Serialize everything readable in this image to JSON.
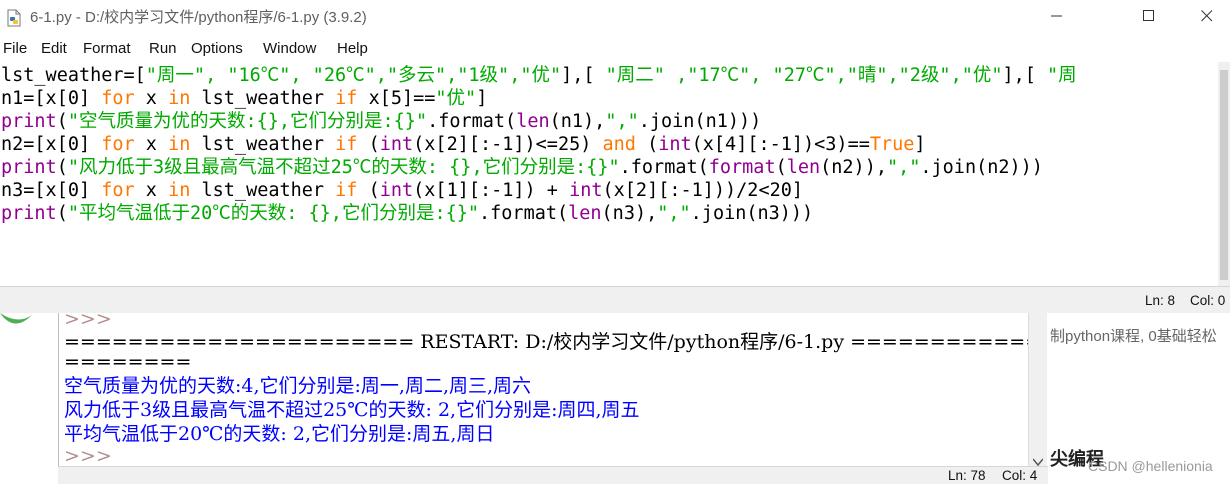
{
  "window": {
    "title": "6-1.py - D:/校内学习文件/python程序/6-1.py (3.9.2)"
  },
  "menu": [
    "File",
    "Edit",
    "Format",
    "Run",
    "Options",
    "Window",
    "Help"
  ],
  "editor": {
    "lines": [
      [
        [
          "t",
          "lst_weather=["
        ],
        [
          "s",
          "\"周一\", \"16℃\", \"26℃\",\"多云\",\"1级\",\"优\""
        ],
        [
          "t",
          "],[ "
        ],
        [
          "s",
          "\"周二\" ,\"17℃\", \"27℃\",\"晴\",\"2级\",\"优\""
        ],
        [
          "t",
          "],[ "
        ],
        [
          "s",
          "\"周"
        ]
      ],
      [
        [
          "t",
          "n1=[x[0] "
        ],
        [
          "k",
          "for"
        ],
        [
          "t",
          " x "
        ],
        [
          "k",
          "in"
        ],
        [
          "t",
          " lst_weather "
        ],
        [
          "k",
          "if"
        ],
        [
          "t",
          " x[5]=="
        ],
        [
          "s",
          "\"优\""
        ],
        [
          "t",
          "]"
        ]
      ],
      [
        [
          "b",
          "print"
        ],
        [
          "t",
          "("
        ],
        [
          "s",
          "\"空气质量为优的天数:{},它们分别是:{}\""
        ],
        [
          "t",
          "."
        ],
        [
          "t",
          "format("
        ],
        [
          "b",
          "len"
        ],
        [
          "t",
          "(n1),"
        ],
        [
          "s",
          "\",\""
        ],
        [
          "t",
          ".join(n1)))"
        ]
      ],
      [
        [
          "t",
          "n2=[x[0] "
        ],
        [
          "k",
          "for"
        ],
        [
          "t",
          " x "
        ],
        [
          "k",
          "in"
        ],
        [
          "t",
          " lst_weather "
        ],
        [
          "k",
          "if"
        ],
        [
          "t",
          " ("
        ],
        [
          "b",
          "int"
        ],
        [
          "t",
          "(x[2][:-1])<=25) "
        ],
        [
          "k",
          "and"
        ],
        [
          "t",
          " ("
        ],
        [
          "b",
          "int"
        ],
        [
          "t",
          "(x[4][:-1])<3)=="
        ],
        [
          "k",
          "True"
        ],
        [
          "t",
          "]"
        ]
      ],
      [
        [
          "b",
          "print"
        ],
        [
          "t",
          "("
        ],
        [
          "s",
          "\"风力低于3级且最高气温不超过25℃的天数: {},它们分别是:{}\""
        ],
        [
          "t",
          ".format("
        ],
        [
          "b",
          "format"
        ],
        [
          "t",
          "("
        ],
        [
          "b",
          "len"
        ],
        [
          "t",
          "(n2)),"
        ],
        [
          "s",
          "\",\""
        ],
        [
          "t",
          ".join(n2)))"
        ]
      ],
      [
        [
          "t",
          "n3=[x[0] "
        ],
        [
          "k",
          "for"
        ],
        [
          "t",
          " x "
        ],
        [
          "k",
          "in"
        ],
        [
          "t",
          " lst_weather "
        ],
        [
          "k",
          "if"
        ],
        [
          "t",
          " ("
        ],
        [
          "b",
          "int"
        ],
        [
          "t",
          "(x[1][:-1]) + "
        ],
        [
          "b",
          "int"
        ],
        [
          "t",
          "(x[2][:-1]))/2<20]"
        ]
      ],
      [
        [
          "b",
          "print"
        ],
        [
          "t",
          "("
        ],
        [
          "s",
          "\"平均气温低于20℃的天数: {},它们分别是:{}\""
        ],
        [
          "t",
          ".format("
        ],
        [
          "b",
          "len"
        ],
        [
          "t",
          "(n3),"
        ],
        [
          "s",
          "\",\""
        ],
        [
          "t",
          ".join(n3)))"
        ]
      ]
    ],
    "status": {
      "ln": "Ln: 8",
      "col": "Col: 0"
    }
  },
  "shell": {
    "prompt": ">>>",
    "restart": "====================== RESTART: D:/校内学习文件/python程序/6-1.py ==============",
    "restart_cont": "========",
    "outputs": [
      "空气质量为优的天数:4,它们分别是:周一,周二,周三,周六",
      "风力低于3级且最高气温不超过25℃的天数: 2,它们分别是:周四,周五",
      "平均气温低于20℃的天数: 2,它们分别是:周五,周日"
    ],
    "status": {
      "ln": "Ln: 78",
      "col": "Col: 4"
    }
  },
  "background": {
    "side_text": "制python课程, 0基础轻松",
    "heading": "尖编程",
    "watermark": "CSDN @hellenionia"
  }
}
